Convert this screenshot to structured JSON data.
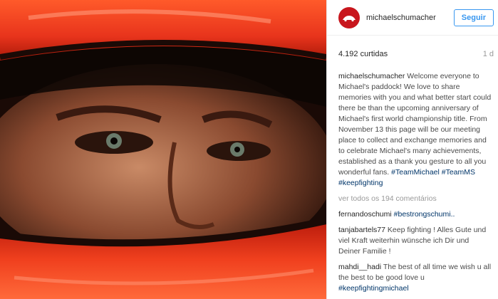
{
  "header": {
    "username": "michaelschumacher",
    "follow_label": "Seguir"
  },
  "post": {
    "likes": "4.192 curtidas",
    "age": "1 d",
    "caption_user": "michaelschumacher",
    "caption_text": "Welcome everyone to Michael's paddock! We love to share memories with you and what better start could there be than the upcoming anniversary of Michael's first world championship title. From November 13 this page will be our meeting place to collect and exchange memories and to celebrate Michael's many achievements, established as a thank you gesture to all you wonderful fans.",
    "caption_tags": "#TeamMichael #TeamMS #keepfighting",
    "view_all": "ver todos os 194 comentários"
  },
  "comments": [
    {
      "user": "fernandoschumi",
      "text": "",
      "tags": "#bestrongschumi.."
    },
    {
      "user": "tanjabartels77",
      "text": "Keep fighting ! Alles Gute und viel Kraft weiterhin wünsche ich Dir und Deiner Familie !",
      "tags": ""
    },
    {
      "user": "mahdi__hadi",
      "text": "The best of all time we wish u all the best to be good love u",
      "tags": "#keepfightingmichael"
    }
  ],
  "colors": {
    "helmet_red": "#e8341c",
    "link_blue": "#003569",
    "follow_blue": "#3897f0"
  }
}
